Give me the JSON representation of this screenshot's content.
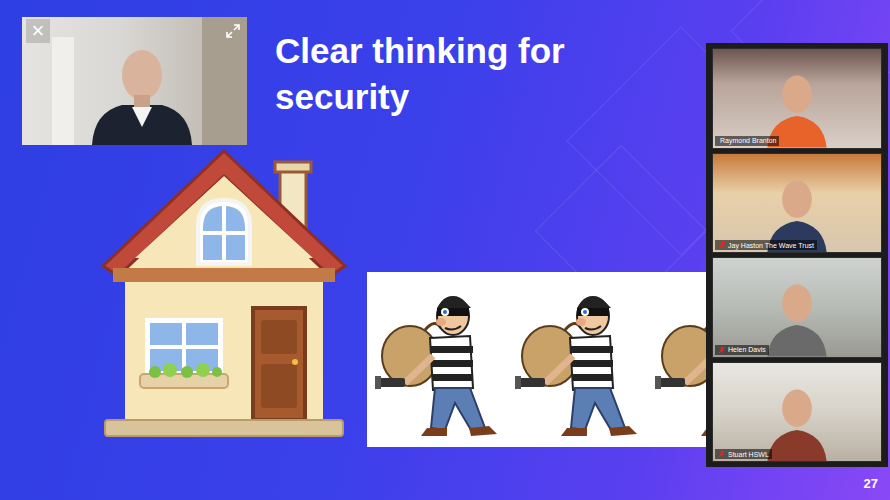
{
  "slide": {
    "title": "Clear thinking for security",
    "page": "27"
  },
  "speaker": {
    "close": "×"
  },
  "participants": [
    {
      "name": "Raymond Branton",
      "muted": false
    },
    {
      "name": "Jay Haston The Wave Trust",
      "muted": true
    },
    {
      "name": "Helen Davis",
      "muted": true
    },
    {
      "name": "Stuart HSWL",
      "muted": true
    }
  ]
}
